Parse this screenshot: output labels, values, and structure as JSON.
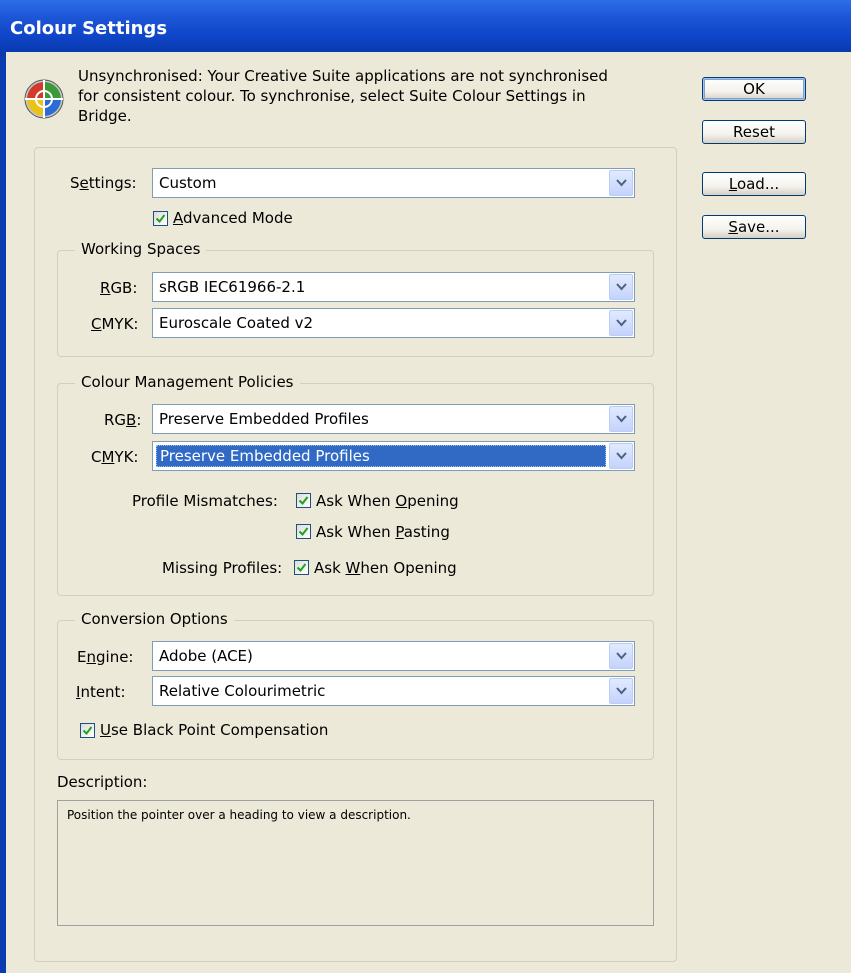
{
  "window": {
    "title": "Colour Settings"
  },
  "sync": {
    "line1": "Unsynchronised: Your Creative Suite applications are not synchronised",
    "line2": "for consistent colour. To synchronise, select Suite Colour Settings in",
    "line3": "Bridge."
  },
  "buttons": {
    "ok": "OK",
    "reset": "Reset",
    "load": {
      "u": "L",
      "rest": "oad..."
    },
    "save": {
      "u": "S",
      "rest": "ave..."
    }
  },
  "settings": {
    "label": {
      "pre": "S",
      "u": "e",
      "rest": "ttings:"
    },
    "value": "Custom",
    "advanced": {
      "pre": "",
      "u": "A",
      "rest": "dvanced Mode",
      "checked": true
    }
  },
  "working_spaces": {
    "title": "Working Spaces",
    "rgb": {
      "label_u": "R",
      "label_rest": "GB:",
      "value": "sRGB IEC61966-2.1"
    },
    "cmyk": {
      "label_u": "C",
      "label_rest": "MYK:",
      "value": "Euroscale Coated v2"
    }
  },
  "policies": {
    "title": "Colour Management Policies",
    "rgb": {
      "pre": "RG",
      "u": "B",
      "rest": ":",
      "value": "Preserve Embedded Profiles"
    },
    "cmyk": {
      "pre": "C",
      "u": "M",
      "rest": "YK:",
      "value": "Preserve Embedded Profiles"
    },
    "mismatch_label": "Profile Mismatches:",
    "ask_opening": {
      "pre": "Ask When ",
      "u": "O",
      "rest": "pening",
      "checked": true
    },
    "ask_pasting": {
      "pre": "Ask When ",
      "u": "P",
      "rest": "asting",
      "checked": true
    },
    "missing_label": "Missing Profiles:",
    "missing_opening": {
      "pre": "Ask ",
      "u": "W",
      "rest": "hen Opening",
      "checked": true
    }
  },
  "conversion": {
    "title": "Conversion Options",
    "engine": {
      "pre": "E",
      "u": "n",
      "rest": "gine:",
      "value": "Adobe (ACE)"
    },
    "intent": {
      "pre": "",
      "u": "I",
      "rest": "ntent:",
      "value": "Relative Colourimetric"
    },
    "bpc": {
      "pre": "",
      "u": "U",
      "rest": "se Black Point Compensation",
      "checked": true
    }
  },
  "description": {
    "label": "Description:",
    "text": "Position the pointer over a heading to view a description."
  }
}
